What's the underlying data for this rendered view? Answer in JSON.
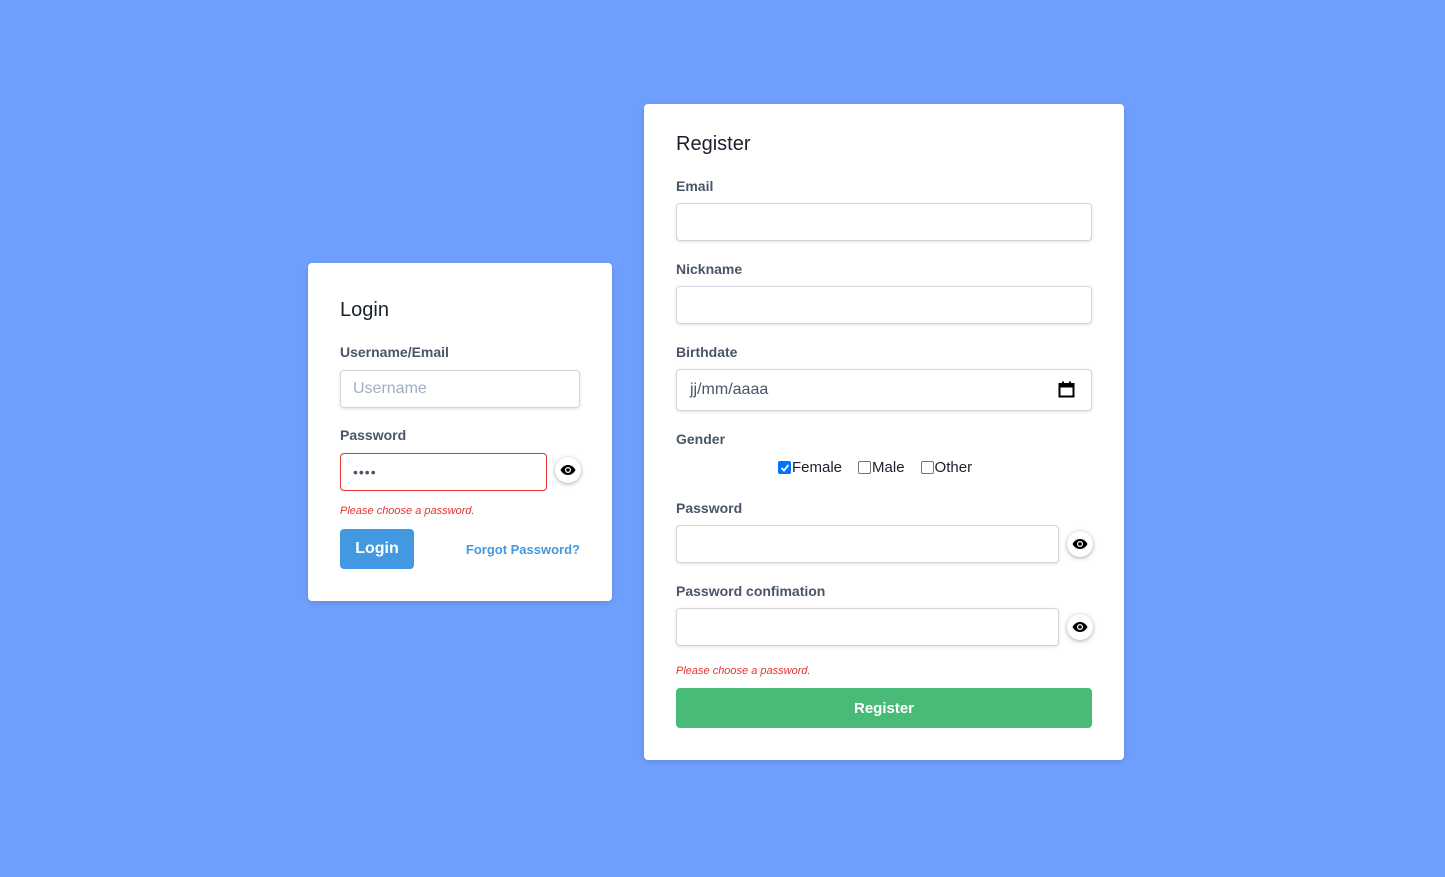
{
  "login": {
    "title": "Login",
    "username_label": "Username/Email",
    "username_placeholder": "Username",
    "username_value": "",
    "password_label": "Password",
    "password_value": "••••",
    "error": "Please choose a password.",
    "login_button": "Login",
    "forgot_link": "Forgot Password?"
  },
  "register": {
    "title": "Register",
    "email_label": "Email",
    "nickname_label": "Nickname",
    "birthdate_label": "Birthdate",
    "birthdate_placeholder": "jj/mm/aaaa",
    "gender_label": "Gender",
    "gender_options": [
      {
        "label": "Female",
        "checked": true
      },
      {
        "label": "Male",
        "checked": false
      },
      {
        "label": "Other",
        "checked": false
      }
    ],
    "password_label": "Password",
    "password_confirm_label": "Password confimation",
    "error": "Please choose a password.",
    "register_button": "Register"
  },
  "colors": {
    "background": "#6f9ffe",
    "primary": "#4299e1",
    "success": "#48bb78",
    "error": "#e3342f"
  },
  "icons": [
    "eye-icon",
    "calendar-icon",
    "checkbox-checked-icon"
  ]
}
